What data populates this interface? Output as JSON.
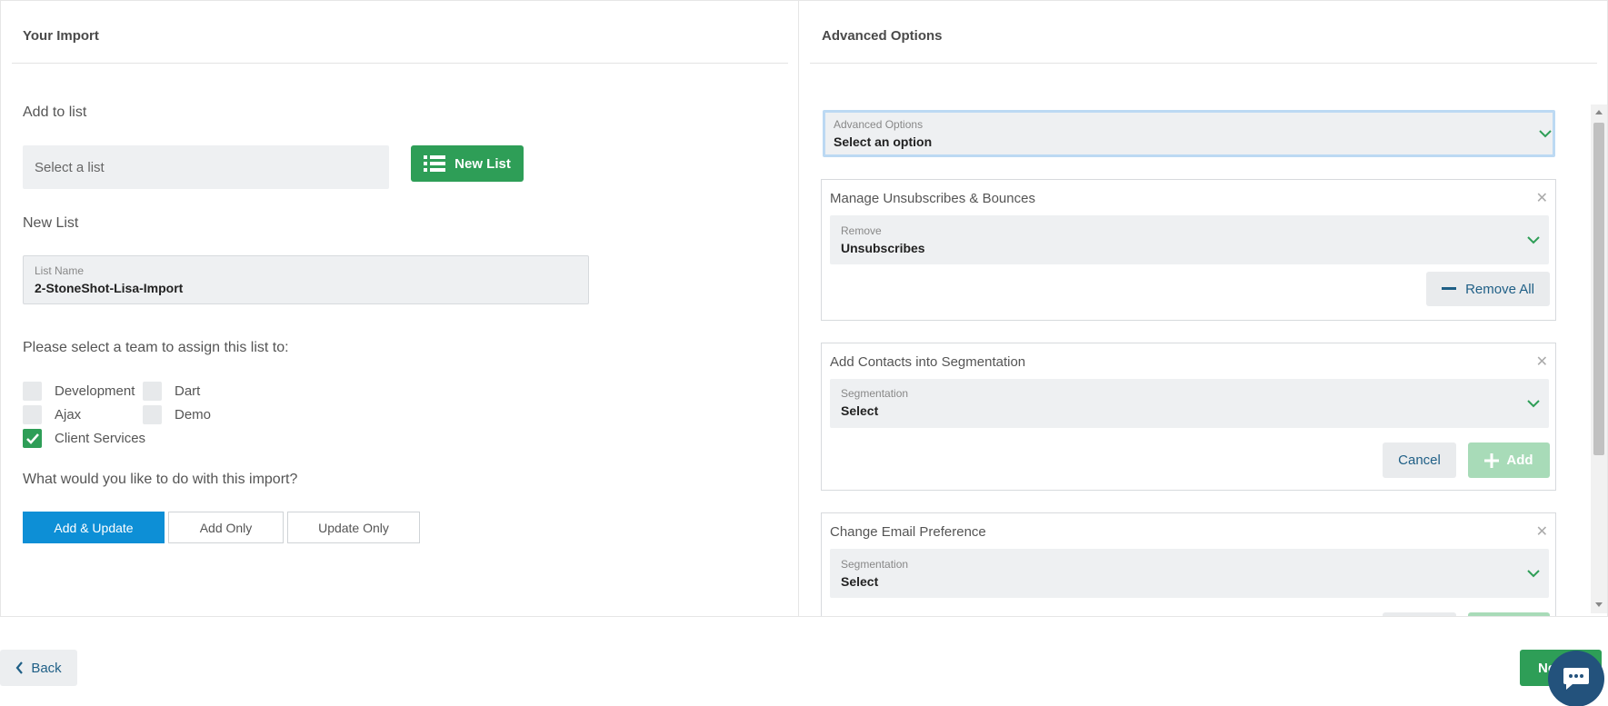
{
  "left": {
    "title": "Your Import",
    "add_to_list_label": "Add to list",
    "select_list_placeholder": "Select a list",
    "new_list_button": "New List",
    "new_list_label": "New List",
    "list_name_label": "List Name",
    "list_name_value": "2-StoneShot-Lisa-Import",
    "team_prompt": "Please select a team to assign this list to:",
    "teams": [
      {
        "label": "Development",
        "checked": false
      },
      {
        "label": "Dart",
        "checked": false
      },
      {
        "label": "Ajax",
        "checked": false
      },
      {
        "label": "Demo",
        "checked": false
      },
      {
        "label": "Client Services",
        "checked": true
      }
    ],
    "import_prompt": "What would you like to do with this import?",
    "modes": [
      "Add & Update",
      "Add Only",
      "Update Only"
    ],
    "selected_mode": "Add & Update"
  },
  "right": {
    "title": "Advanced Options",
    "select_label": "Advanced Options",
    "select_value": "Select an option",
    "cards": [
      {
        "title": "Manage Unsubscribes & Bounces",
        "field_label": "Remove",
        "field_value": "Unsubscribes",
        "action": "Remove All"
      },
      {
        "title": "Add Contacts into Segmentation",
        "field_label": "Segmentation",
        "field_value": "Select",
        "cancel": "Cancel",
        "add": "Add"
      },
      {
        "title": "Change Email Preference",
        "field_label": "Segmentation",
        "field_value": "Select"
      }
    ]
  },
  "footer": {
    "back": "Back",
    "next": "Ne"
  },
  "colors": {
    "green": "#2e9e57",
    "blue_active": "#0d8fd6",
    "link_blue": "#1f5f86"
  },
  "icons": [
    "list-icon",
    "chevron-down-icon",
    "close-icon",
    "minus-icon",
    "plus-icon",
    "chevron-left-icon",
    "chat-icon",
    "checkmark-icon"
  ]
}
